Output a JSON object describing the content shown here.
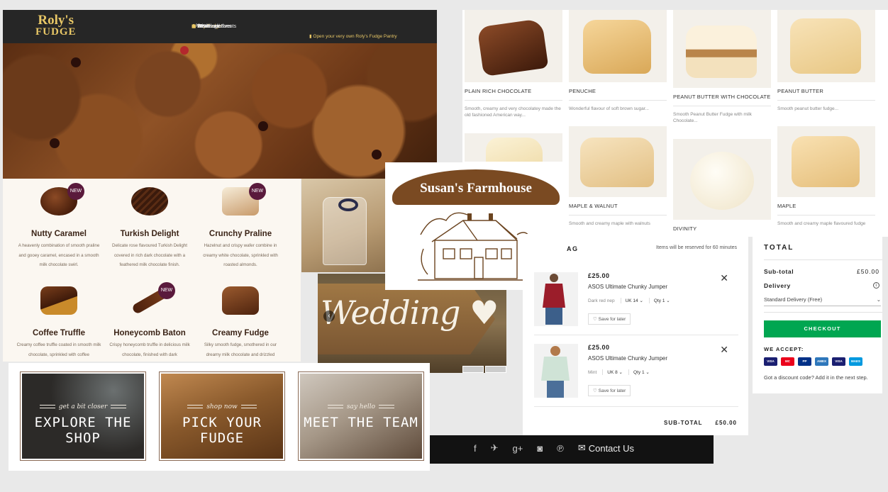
{
  "rolys": {
    "logo_line1": "Roly's",
    "logo_line2": "FUDGE",
    "nav": [
      {
        "label": "Home",
        "icon": "home-icon"
      },
      {
        "label": "Buy Fudge",
        "icon": "cart-icon"
      },
      {
        "label": "News and Events",
        "icon": "calendar-icon"
      },
      {
        "label": "Weddings",
        "icon": "bell-icon"
      },
      {
        "label": "Wholesale",
        "icon": "people-icon"
      },
      {
        "label": "Store Locations",
        "icon": "location-icon"
      }
    ],
    "active_nav": "Buy Fudge",
    "pantry_link": "Open your very own Roly's Fudge Pantry",
    "accent_color": "#e8c766"
  },
  "grid": {
    "products": [
      {
        "name": "PLAIN RICH CHOCOLATE",
        "desc": "Smooth, creamy and very chocolatey made the old fashioned American way..."
      },
      {
        "name": "PENUCHE",
        "desc": "Wonderful flavour of soft brown sugar..."
      },
      {
        "name": "PEANUT BUTTER WITH CHOCOLATE",
        "desc": "Smooth Peanut Butter Fudge with milk Chocolate..."
      },
      {
        "name": "PEANUT BUTTER",
        "desc": "Smooth peanut butter fudge..."
      },
      {
        "name": "MAPLE & WALNUT",
        "desc": "Smooth and creamy maple with walnuts"
      },
      {
        "name": "DIVINITY",
        "desc": ""
      },
      {
        "name": "MAPLE",
        "desc": "Smooth and creamy maple flavoured fudge"
      }
    ]
  },
  "chocolates": [
    {
      "name": "Nutty Caramel",
      "desc": "A heavenly combination of smooth praline and gooey caramel, encased in a smooth milk chocolate swirl.",
      "new": true
    },
    {
      "name": "Turkish Delight",
      "desc": "Delicate rose flavoured Turkish Delight covered in rich dark chocolate with a feathered milk chocolate finish.",
      "new": false
    },
    {
      "name": "Crunchy Praline",
      "desc": "Hazelnut and crispy wafer combine in creamy white chocolate, sprinkled with roasted almonds.",
      "new": true
    },
    {
      "name": "Coffee Truffle",
      "desc": "Creamy coffee truffle coated in smooth milk chocolate, sprinkled with coffee",
      "new": false
    },
    {
      "name": "Honeycomb Baton",
      "desc": "Crispy honeycomb truffle in delicious milk chocolate, finished with dark",
      "new": true
    },
    {
      "name": "Creamy Fudge",
      "desc": "Silky smooth fudge, smothered in our dreamy milk chocolate and drizzled",
      "new": false
    }
  ],
  "new_badge": "NEW",
  "susans": {
    "title": "Susan's Farmhouse"
  },
  "wedding": {
    "word": "Wedding",
    "heart": "♥"
  },
  "bag": {
    "heading": "AG",
    "reserve_note": "Items will be reserved for 60 minutes",
    "items": [
      {
        "price": "£25.00",
        "title": "ASOS Ultimate Chunky Jumper",
        "colour": "Dark red nep",
        "size": "UK 14",
        "qty_label": "Qty",
        "qty": "1",
        "save": "Save for later"
      },
      {
        "price": "£25.00",
        "title": "ASOS Ultimate Chunky Jumper",
        "colour": "Mint",
        "size": "UK 8",
        "qty_label": "Qty",
        "qty": "1",
        "save": "Save for later"
      }
    ],
    "subtotal_label": "SUB-TOTAL",
    "subtotal_value": "£50.00"
  },
  "total": {
    "heading": "TOTAL",
    "subtotal_label": "Sub-total",
    "subtotal_value": "£50.00",
    "delivery_label": "Delivery",
    "delivery_option": "Standard Delivery (Free)",
    "checkout": "CHECKOUT",
    "accept_label": "WE ACCEPT:",
    "cards": [
      {
        "label": "VISA",
        "color": "#1a1f71"
      },
      {
        "label": "MC",
        "color": "#eb001b"
      },
      {
        "label": "PP",
        "color": "#003087"
      },
      {
        "label": "AMEX",
        "color": "#2e77bb"
      },
      {
        "label": "VISA",
        "color": "#1a1f71"
      },
      {
        "label": "MAES",
        "color": "#0099df"
      }
    ],
    "discount_note": "Got a discount code? Add it in the next step.",
    "checkout_color": "#00a651"
  },
  "footer": {
    "social": [
      "f",
      "🐦",
      "g+",
      "◙",
      "℗"
    ],
    "contact": "Contact Us"
  },
  "tiles": [
    {
      "sub": "get a bit closer",
      "main": "EXPLORE THE SHOP"
    },
    {
      "sub": "shop now",
      "main": "PICK YOUR FUDGE"
    },
    {
      "sub": "say hello",
      "main": "MEET THE TEAM"
    }
  ]
}
